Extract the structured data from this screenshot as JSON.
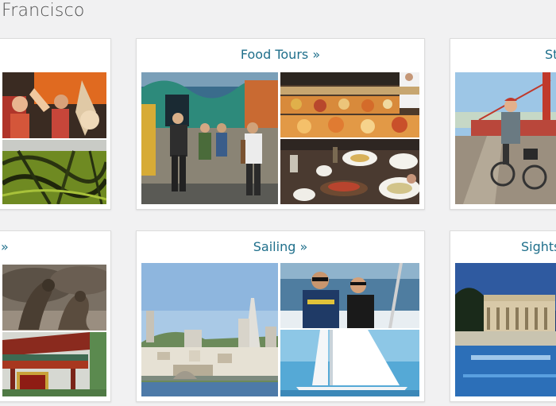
{
  "page": {
    "title": "Francisco"
  },
  "cards": [
    {
      "id": "card-tl",
      "title": ""
    },
    {
      "id": "food",
      "title": "Food Tours »"
    },
    {
      "id": "card-tr",
      "title": "St"
    },
    {
      "id": "card-bl",
      "title": "»"
    },
    {
      "id": "sailing",
      "title": "Sailing »"
    },
    {
      "id": "sights",
      "title": "Sights"
    }
  ],
  "colors": {
    "link": "#1f6f8b",
    "page_bg": "#f1f1f2",
    "card_bg": "#ffffff",
    "title_gray": "#505050"
  }
}
